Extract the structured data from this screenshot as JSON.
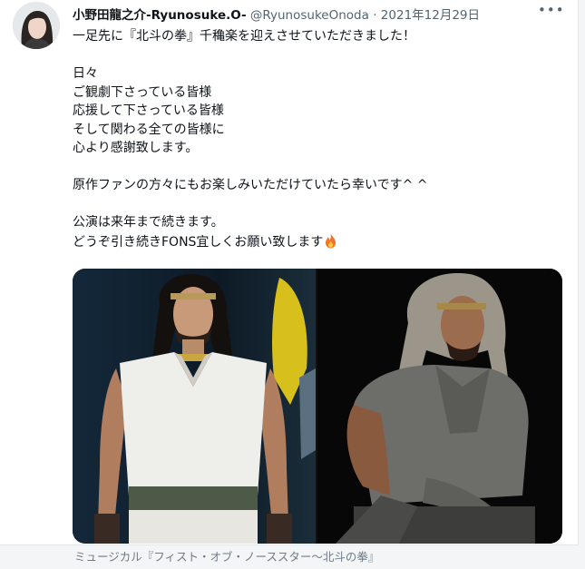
{
  "tweet": {
    "display_name": "小野田龍之介-Ryunosuke.O-",
    "handle": "@RyunosukeOnoda",
    "separator": "·",
    "date": "2021年12月29日",
    "more_icon": "ellipsis-icon",
    "text": "一足先に『北斗の拳』千穐楽を迎えさせていただきました！\n\n日々\nご観劇下さっている皆様\n応援して下さっている皆様\nそして関わる全ての皆様に\n心より感謝致します。\n\n原作ファンの方々にもお楽しみいただけていたら幸いです^ ^\n\n公演は来年まで続きます。\nどうぞ引き続きFONS宜しくお願い致します",
    "emoji": "fire-icon"
  },
  "caption": "ミュージカル『フィスト・オブ・ノーススター～北斗の拳』",
  "colors": {
    "text": "#0f1419",
    "secondary": "#536471",
    "caption": "#6f7b85"
  }
}
